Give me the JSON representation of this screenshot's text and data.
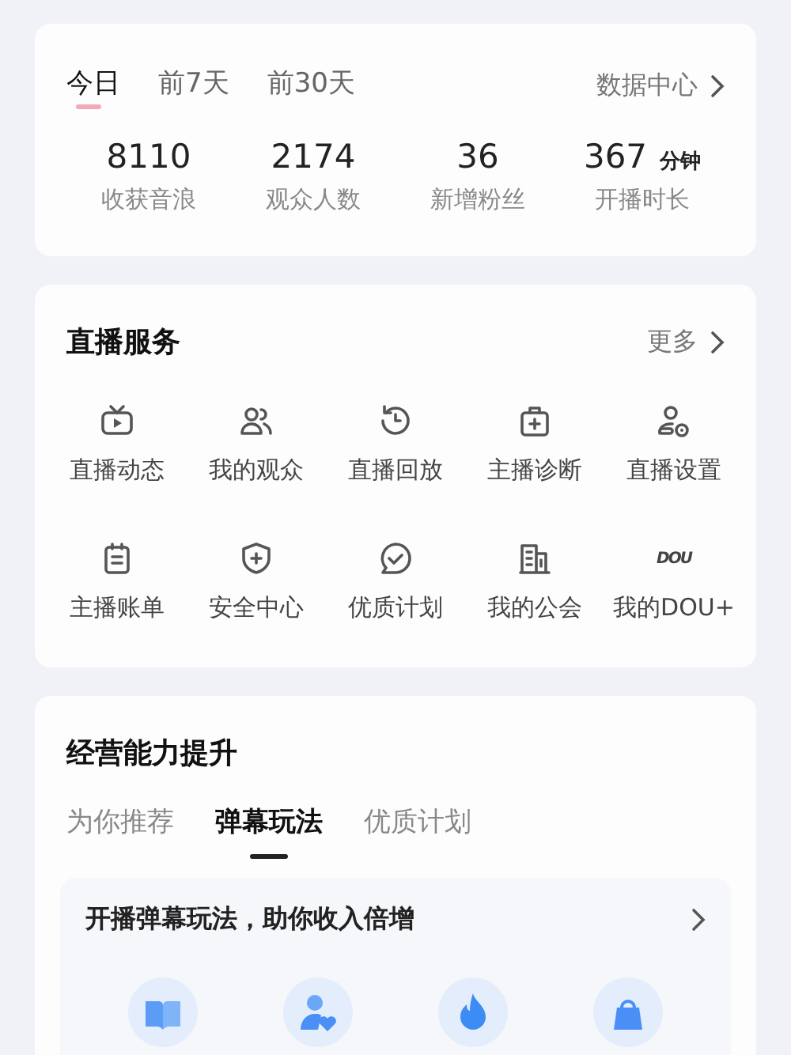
{
  "overview": {
    "periods": [
      {
        "label": "今日",
        "selected": true
      },
      {
        "label": "前7天",
        "selected": false
      },
      {
        "label": "前30天",
        "selected": false
      }
    ],
    "link": "数据中心",
    "stats": [
      {
        "value": "8110",
        "label": "收获音浪"
      },
      {
        "value": "2174",
        "label": "观众人数"
      },
      {
        "value": "36",
        "label": "新增粉丝"
      },
      {
        "value": "367",
        "unit": "分钟",
        "label": "开播时长"
      }
    ]
  },
  "services": {
    "title": "直播服务",
    "more": "更多",
    "items": [
      {
        "label": "直播动态"
      },
      {
        "label": "我的观众"
      },
      {
        "label": "直播回放"
      },
      {
        "label": "主播诊断"
      },
      {
        "label": "直播设置"
      },
      {
        "label": "主播账单"
      },
      {
        "label": "安全中心"
      },
      {
        "label": "优质计划"
      },
      {
        "label": "我的公会"
      },
      {
        "label": "我的DOU+",
        "logo_text": "DOU"
      }
    ]
  },
  "growth": {
    "title": "经营能力提升",
    "tabs": [
      {
        "label": "为你推荐",
        "selected": false
      },
      {
        "label": "弹幕玩法",
        "selected": true
      },
      {
        "label": "优质计划",
        "selected": false
      }
    ],
    "banner": {
      "title": "开播弹幕玩法，助你收入倍增"
    }
  }
}
